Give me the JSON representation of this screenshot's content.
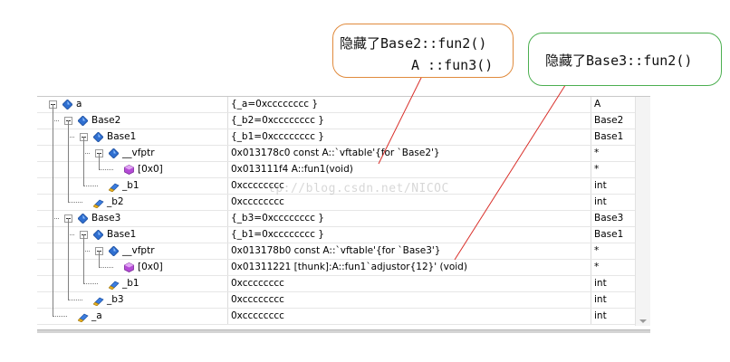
{
  "watch": {
    "rows": [
      {
        "name": "a",
        "value": "{_a=0xcccccccc }",
        "type": "A",
        "icon": "class-icon"
      },
      {
        "name": "Base2",
        "value": "{_b2=0xcccccccc }",
        "type": "Base2",
        "icon": "class-icon"
      },
      {
        "name": "Base1",
        "value": "{_b1=0xcccccccc }",
        "type": "Base1",
        "icon": "class-icon"
      },
      {
        "name": "__vfptr",
        "value": "0x013178c0 const A::`vftable'{for `Base2'}",
        "type": "*",
        "icon": "class-icon"
      },
      {
        "name": "[0x0]",
        "value": "0x013111f4 A::fun1(void)",
        "type": "*",
        "icon": "method-icon"
      },
      {
        "name": "_b1",
        "value": "0xcccccccc",
        "type": "int",
        "icon": "field-icon"
      },
      {
        "name": "_b2",
        "value": "0xcccccccc",
        "type": "int",
        "icon": "field-icon"
      },
      {
        "name": "Base3",
        "value": "{_b3=0xcccccccc }",
        "type": "Base3",
        "icon": "class-icon"
      },
      {
        "name": "Base1",
        "value": "{_b1=0xcccccccc }",
        "type": "Base1",
        "icon": "class-icon"
      },
      {
        "name": "__vfptr",
        "value": "0x013178b0 const A::`vftable'{for `Base3'}",
        "type": "*",
        "icon": "class-icon"
      },
      {
        "name": "[0x0]",
        "value": "0x01311221 [thunk]:A::fun1`adjustor{12}' (void)",
        "type": "*",
        "icon": "method-icon"
      },
      {
        "name": "_b1",
        "value": "0xcccccccc",
        "type": "int",
        "icon": "field-icon"
      },
      {
        "name": "_b3",
        "value": "0xcccccccc",
        "type": "int",
        "icon": "field-icon"
      },
      {
        "name": "_a",
        "value": "0xcccccccc",
        "type": "int",
        "icon": "field-icon"
      }
    ]
  },
  "annotations": {
    "callout1": {
      "line1": "隐藏了Base2::fun2()",
      "line2": "A ::fun3()",
      "border_color": "#e08a3c"
    },
    "callout2": {
      "line1": "隐藏了Base3::fun2()",
      "border_color": "#4caf50"
    },
    "pointer_color": "#d9302b"
  },
  "watermark": "tp://blog.csdn.net/NICOC"
}
